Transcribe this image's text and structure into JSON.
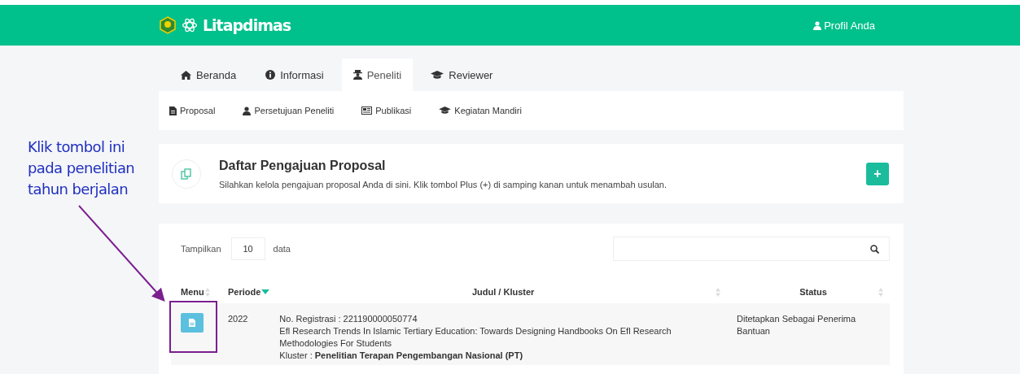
{
  "header": {
    "brand": "Litapdimas",
    "profile": "Profil Anda"
  },
  "tabs": [
    {
      "label": "Beranda",
      "kind": "home",
      "selected": false
    },
    {
      "label": "Informasi",
      "kind": "info",
      "selected": false
    },
    {
      "label": "Peneliti",
      "kind": "researcher",
      "selected": true
    },
    {
      "label": "Reviewer",
      "kind": "cap",
      "selected": false
    }
  ],
  "subnav": [
    {
      "label": "Proposal",
      "kind": "file"
    },
    {
      "label": "Persetujuan Peneliti",
      "kind": "user"
    },
    {
      "label": "Publikasi",
      "kind": "newspaper"
    },
    {
      "label": "Kegiatan Mandiri",
      "kind": "cap"
    }
  ],
  "intro": {
    "title": "Daftar Pengajuan Proposal",
    "description": "Silahkan kelola pengajuan proposal Anda di sini. Klik tombol Plus (+) di samping kanan untuk menambah usulan.",
    "add_button": "+"
  },
  "table": {
    "show_label": "Tampilkan",
    "page_length": "10",
    "data_label": "data",
    "columns": [
      {
        "label": "Menu",
        "kind": "sortable"
      },
      {
        "label": "Periode",
        "kind": "sorted"
      },
      {
        "label": "Judul / Kluster",
        "kind": "sortable"
      },
      {
        "label": "Status",
        "kind": "sortable"
      }
    ],
    "rows": [
      {
        "periode": "2022",
        "registration": "No. Registrasi : 221190000050774",
        "title": "Efl Research Trends In Islamic Tertiary Education: Towards Designing Handbooks On Efl Research Methodologies For Students",
        "cluster": "Kluster : **Penelitian Terapan Pengembangan Nasional (PT)**",
        "status": "Ditetapkan Sebagai Penerima Bantuan"
      }
    ]
  },
  "annotation": {
    "text": "Klik tombol ini pada penelitian tahun berjalan"
  }
}
